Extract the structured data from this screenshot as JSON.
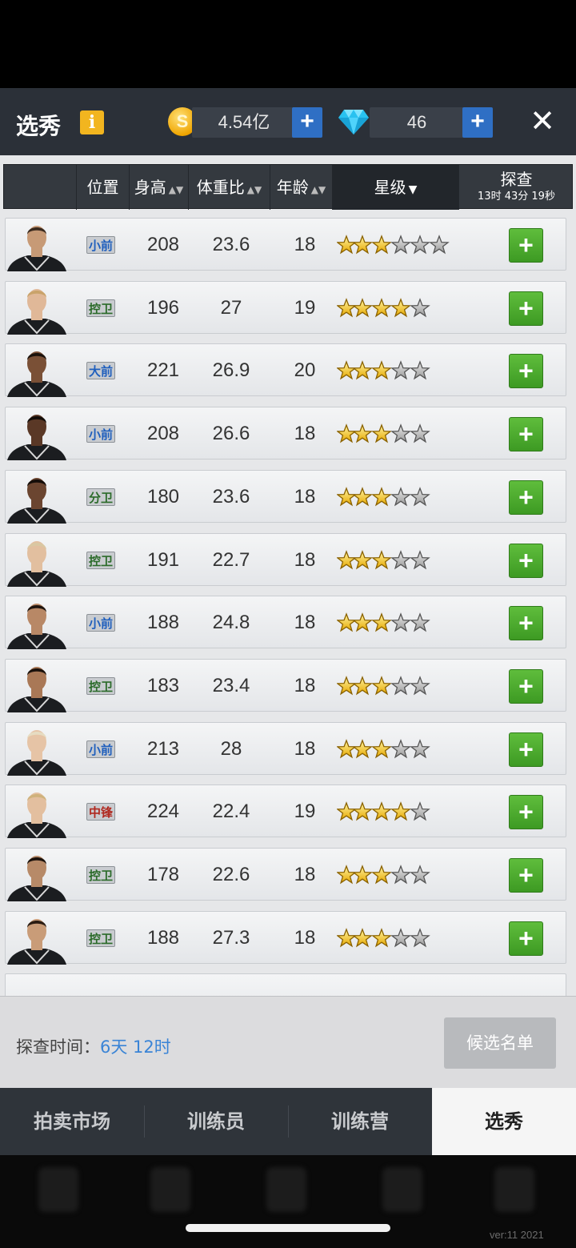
{
  "header": {
    "title": "选秀",
    "info_label": "i",
    "coins_value": "4.54亿",
    "gems_value": "46",
    "plus_label": "+",
    "close_label": "✕"
  },
  "table": {
    "headers": {
      "position": "位置",
      "height": "身高",
      "weight_ratio": "体重比",
      "age": "年龄",
      "stars": "星级",
      "scout": "探查",
      "scout_timer": "13时 43分 19秒"
    },
    "sort_icon": "updown-triangle-icon",
    "stars_sort_icon": "triangle-down-icon"
  },
  "rows": [
    {
      "position": "小前",
      "pos_color": "#1f5fbd",
      "height": "208",
      "weight_ratio": "23.6",
      "age": "18",
      "stars": 3,
      "max_stars": 6,
      "skin": "#c79a76",
      "hair": "#3a2a1e"
    },
    {
      "position": "控卫",
      "pos_color": "#2b6b2a",
      "height": "196",
      "weight_ratio": "27",
      "age": "19",
      "stars": 4,
      "max_stars": 5.5,
      "skin": "#e0b898",
      "hair": "#c9a36a"
    },
    {
      "position": "大前",
      "pos_color": "#1f5fbd",
      "height": "221",
      "weight_ratio": "26.9",
      "age": "20",
      "stars": 3,
      "max_stars": 5.5,
      "skin": "#7a5036",
      "hair": "#1b120c"
    },
    {
      "position": "小前",
      "pos_color": "#1f5fbd",
      "height": "208",
      "weight_ratio": "26.6",
      "age": "18",
      "stars": 3,
      "max_stars": 5.5,
      "skin": "#5a3826",
      "hair": "#120c08"
    },
    {
      "position": "分卫",
      "pos_color": "#2b6b2a",
      "height": "180",
      "weight_ratio": "23.6",
      "age": "18",
      "stars": 3,
      "max_stars": 5.5,
      "skin": "#6b4530",
      "hair": "#140d09"
    },
    {
      "position": "控卫",
      "pos_color": "#2b6b2a",
      "height": "191",
      "weight_ratio": "22.7",
      "age": "18",
      "stars": 3,
      "max_stars": 5,
      "skin": "#e2bf9f",
      "hair": "#d9c7a2"
    },
    {
      "position": "小前",
      "pos_color": "#1f5fbd",
      "height": "188",
      "weight_ratio": "24.8",
      "age": "18",
      "stars": 3,
      "max_stars": 5,
      "skin": "#b88866",
      "hair": "#1e140e"
    },
    {
      "position": "控卫",
      "pos_color": "#2b6b2a",
      "height": "183",
      "weight_ratio": "23.4",
      "age": "18",
      "stars": 3,
      "max_stars": 5,
      "skin": "#a97856",
      "hair": "#1a110b"
    },
    {
      "position": "小前",
      "pos_color": "#1f5fbd",
      "height": "213",
      "weight_ratio": "28",
      "age": "18",
      "stars": 3,
      "max_stars": 5,
      "skin": "#e6c4a6",
      "hair": "#e6dcc2"
    },
    {
      "position": "中锋",
      "pos_color": "#b0281f",
      "height": "224",
      "weight_ratio": "22.4",
      "age": "19",
      "stars": 4,
      "max_stars": 5,
      "skin": "#e3bf9f",
      "hair": "#cfb27c"
    },
    {
      "position": "控卫",
      "pos_color": "#2b6b2a",
      "height": "178",
      "weight_ratio": "22.6",
      "age": "18",
      "stars": 3,
      "max_stars": 5,
      "skin": "#b78a68",
      "hair": "#1b120c"
    },
    {
      "position": "控卫",
      "pos_color": "#2b6b2a",
      "height": "188",
      "weight_ratio": "27.3",
      "age": "18",
      "stars": 3,
      "max_stars": 5,
      "skin": "#c99c78",
      "hair": "#2a1c12"
    }
  ],
  "footer": {
    "scout_time_label": "探查时间：",
    "scout_time_value": "6天 12时",
    "candidate_button": "候选名单"
  },
  "tabs": [
    {
      "label": "拍卖市场",
      "active": false
    },
    {
      "label": "训练员",
      "active": false
    },
    {
      "label": "训练营",
      "active": false
    },
    {
      "label": "选秀",
      "active": true
    }
  ],
  "version": "ver:11  2021",
  "colors": {
    "topbar": "#2b3038",
    "plus_blue": "#2f6fc4",
    "add_green": "#4aa82c",
    "scout_time_blue": "#3a84d6"
  }
}
